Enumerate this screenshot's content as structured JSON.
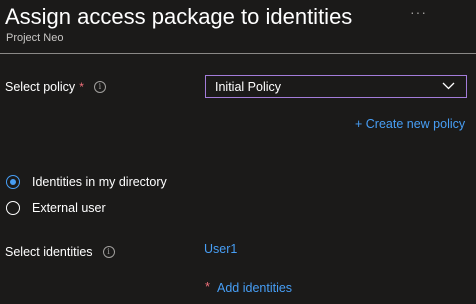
{
  "header": {
    "title": "Assign access package to identities",
    "more_label": "···",
    "subtitle": "Project Neo"
  },
  "form": {
    "policy": {
      "label": "Select policy",
      "required_marker": "*",
      "info_icon": "info-icon",
      "selected_value": "Initial Policy",
      "create_link": "+ Create new policy"
    },
    "identity_source": {
      "options": [
        {
          "label": "Identities in my directory",
          "checked": true
        },
        {
          "label": "External user",
          "checked": false
        }
      ]
    },
    "identities": {
      "label": "Select identities",
      "info_icon": "info-icon",
      "selected": [
        "User1"
      ],
      "required_marker": "*",
      "add_link": "Add identities"
    }
  },
  "colors": {
    "background": "#1b1a19",
    "link": "#479ef5",
    "required": "#f1707b",
    "dropdown_border": "#a37cd9"
  }
}
